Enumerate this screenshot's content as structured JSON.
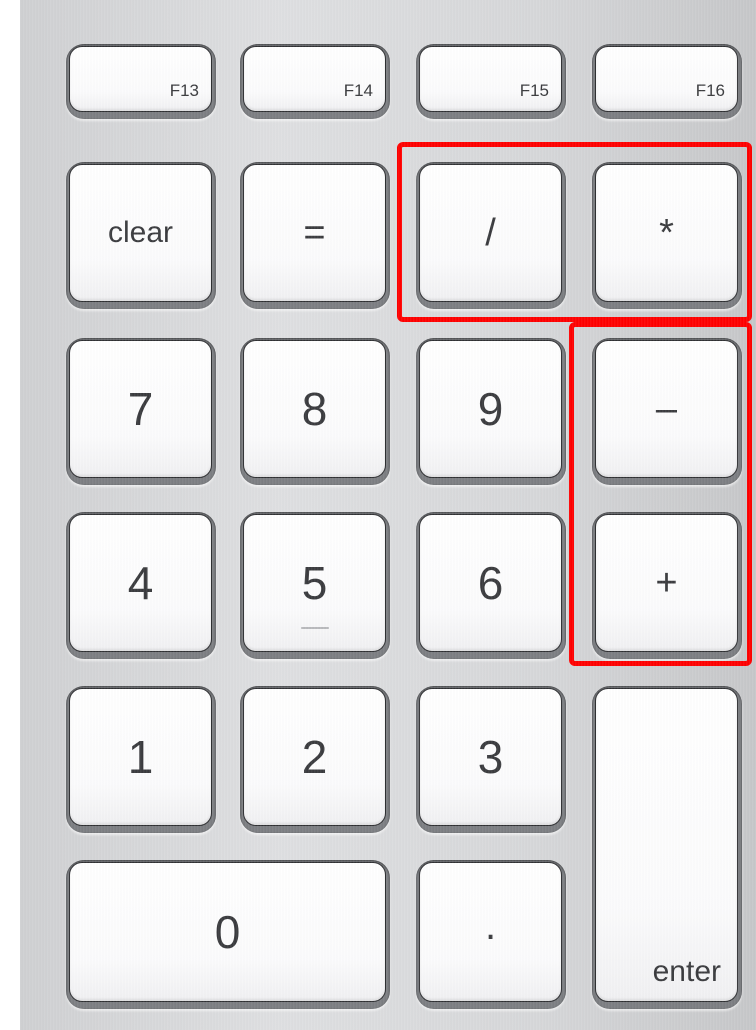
{
  "function_row": [
    {
      "id": "f13",
      "label": "F13"
    },
    {
      "id": "f14",
      "label": "F14"
    },
    {
      "id": "f15",
      "label": "F15"
    },
    {
      "id": "f16",
      "label": "F16"
    }
  ],
  "keys": {
    "clear": "clear",
    "equals": "=",
    "divide": "/",
    "multiply": "*",
    "seven": "7",
    "eight": "8",
    "nine": "9",
    "minus": "–",
    "four": "4",
    "five": "5",
    "six": "6",
    "plus": "+",
    "one": "1",
    "two": "2",
    "three": "3",
    "zero": "0",
    "decimal": ".",
    "enter": "enter"
  },
  "colors": {
    "highlight": "#ff0000",
    "key_face": "#ffffff",
    "aluminum": "#d6d7d9"
  }
}
